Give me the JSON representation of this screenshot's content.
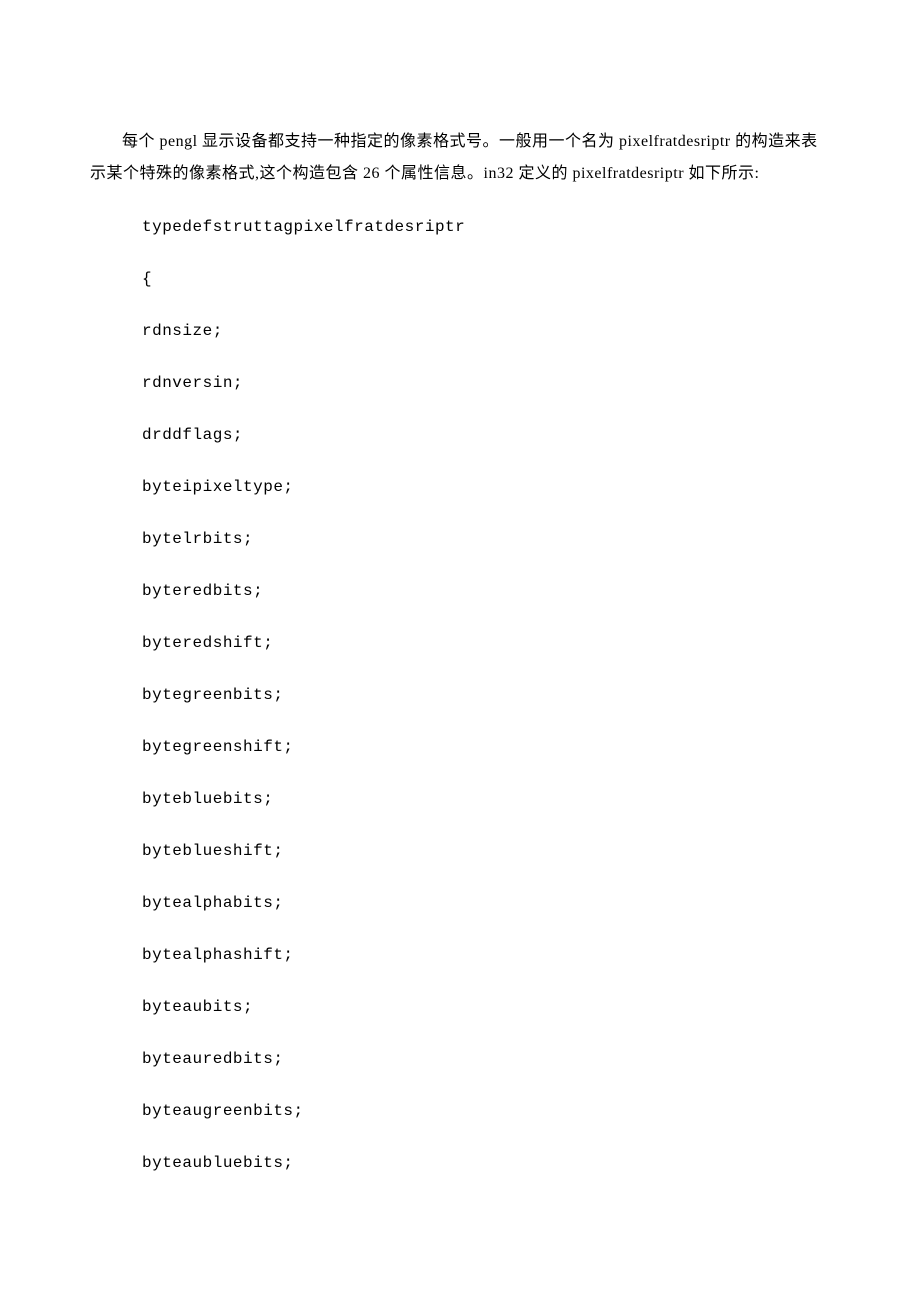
{
  "intro": "每个 pengl 显示设备都支持一种指定的像素格式号。一般用一个名为 pixelfratdesriptr 的构造来表示某个特殊的像素格式,这个构造包含 26 个属性信息。in32 定义的 pixelfratdesriptr 如下所示:",
  "code_lines": [
    "typedefstruttagpixelfratdesriptr",
    "{",
    "rdnsize;",
    "rdnversin;",
    "drddflags;",
    "byteipixeltype;",
    "bytelrbits;",
    "byteredbits;",
    "byteredshift;",
    "bytegreenbits;",
    "bytegreenshift;",
    "bytebluebits;",
    "byteblueshift;",
    "bytealphabits;",
    "bytealphashift;",
    "byteaubits;",
    "byteauredbits;",
    "byteaugreenbits;",
    "byteaubluebits;"
  ]
}
